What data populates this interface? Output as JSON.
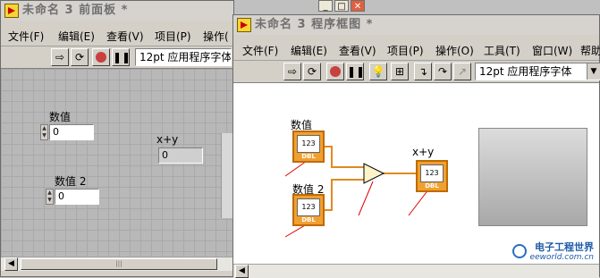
{
  "front_panel": {
    "title": "未命名 3 前面板 *",
    "menus": [
      "文件(F)",
      "编辑(E)",
      "查看(V)",
      "项目(P)",
      "操作("
    ],
    "font_selector": "12pt 应用程序字体",
    "controls": [
      {
        "label": "数值",
        "value": "0"
      },
      {
        "label": "数值 2",
        "value": "0"
      }
    ],
    "indicator": {
      "label": "x+y",
      "value": "0"
    },
    "scrollbar_grip": "|||"
  },
  "block_diagram": {
    "title": "未命名 3 程序框图 *",
    "menus": [
      "文件(F)",
      "编辑(E)",
      "查看(V)",
      "项目(P)",
      "操作(O)",
      "工具(T)",
      "窗口(W)",
      "帮助"
    ],
    "font_selector": "12pt 应用程序字体",
    "terminals": [
      {
        "label": "数值",
        "type": "DBL",
        "value_text": "123"
      },
      {
        "label": "数值 2",
        "type": "DBL",
        "value_text": "123"
      }
    ],
    "output_terminal": {
      "label": "x+y",
      "type": "DBL",
      "value_text": "123"
    },
    "accent_color": "#f0a030",
    "wire_color": "#f0a030"
  },
  "watermark": {
    "brand": "电子工程世界",
    "url": "eeworld.com.cn"
  }
}
